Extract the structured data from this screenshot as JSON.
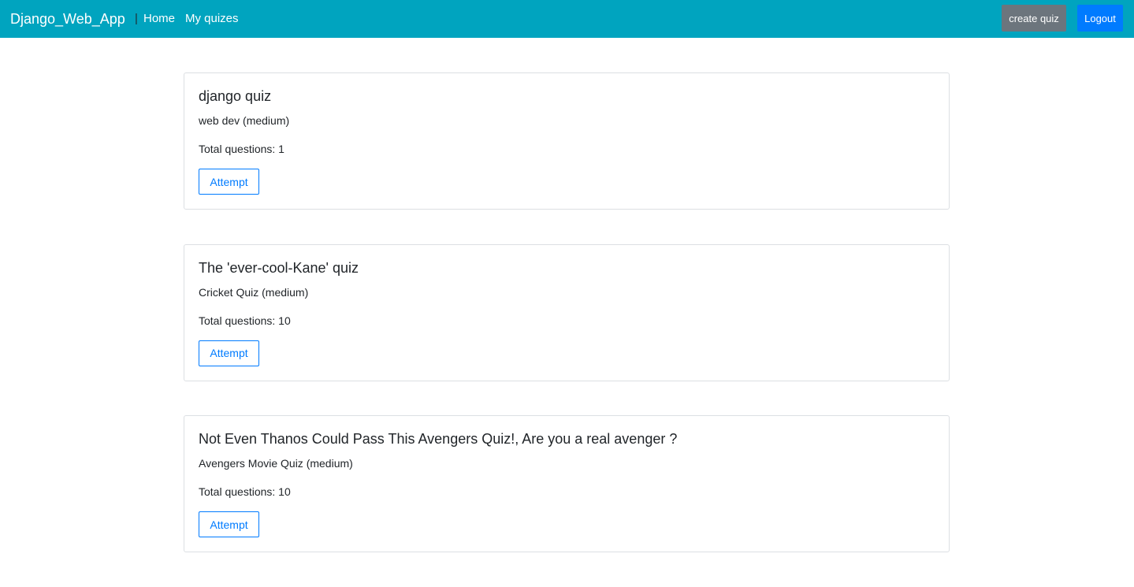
{
  "navbar": {
    "brand": "Django_Web_App",
    "separator": "|",
    "links": [
      {
        "label": "Home"
      },
      {
        "label": "My quizes"
      }
    ],
    "create_quiz_label": "create quiz",
    "logout_label": "Logout",
    "colors": {
      "background": "#00a4bf",
      "create_button": "#6c757d",
      "logout_button": "#007bff"
    }
  },
  "quizzes": [
    {
      "title": "django quiz",
      "subtitle": "web dev (medium)",
      "total_questions": "Total questions: 1",
      "action_label": "Attempt"
    },
    {
      "title": "The 'ever-cool-Kane' quiz",
      "subtitle": "Cricket Quiz (medium)",
      "total_questions": "Total questions: 10",
      "action_label": "Attempt"
    },
    {
      "title": "Not Even Thanos Could Pass This Avengers Quiz!, Are you a real avenger ?",
      "subtitle": "Avengers Movie Quiz (medium)",
      "total_questions": "Total questions: 10",
      "action_label": "Attempt"
    }
  ],
  "colors": {
    "accent": "#007bff",
    "card_border": "#dcdfe3"
  }
}
